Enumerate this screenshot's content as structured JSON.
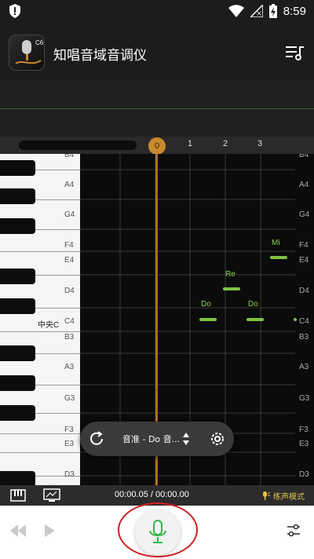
{
  "status_bar": {
    "time": "8:59"
  },
  "header": {
    "title": "知唱音域音调仪",
    "logo_text": "C6"
  },
  "timeline": {
    "ticks": [
      "0",
      "1",
      "2",
      "3"
    ]
  },
  "keyboard": {
    "left_labels": [
      "B4",
      "A4",
      "G4",
      "F4",
      "E4",
      "D4",
      "中央C",
      "C4",
      "B3",
      "A3",
      "G3",
      "F3",
      "E3",
      "D3"
    ],
    "right_labels": [
      "B4",
      "A4",
      "G4",
      "F4",
      "E4",
      "D4",
      "C4",
      "B3",
      "A3",
      "G3",
      "F3",
      "E3",
      "D3"
    ]
  },
  "notes": [
    {
      "name": "Do",
      "pitch": "C4"
    },
    {
      "name": "Re",
      "pitch": "D4"
    },
    {
      "name": "Do",
      "pitch": "C4"
    },
    {
      "name": "Mi",
      "pitch": "E4"
    }
  ],
  "tuner": {
    "label": "音准 - Do 音..."
  },
  "playback": {
    "timecode": "00:00.05 / 00:00.00",
    "mode_label": "练声模式"
  },
  "colors": {
    "accent_green": "#7fc242",
    "playhead": "#c98a2f",
    "mode_yellow": "#e4c14a"
  }
}
